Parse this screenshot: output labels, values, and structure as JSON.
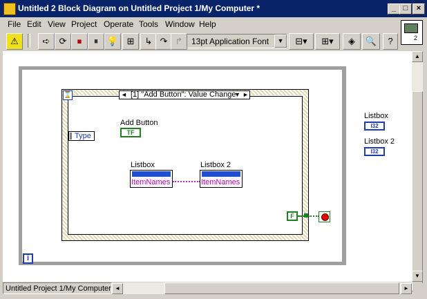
{
  "window": {
    "title": "Untitled 2 Block Diagram on Untitled Project 1/My Computer *"
  },
  "menu": {
    "items": [
      "File",
      "Edit",
      "View",
      "Project",
      "Operate",
      "Tools",
      "Window",
      "Help"
    ]
  },
  "toolbar": {
    "font": "13pt Application Font"
  },
  "diagram": {
    "case_selector": "[1] \"Add Button\": Value Change",
    "type_label": "Type",
    "add_button_label": "Add Button",
    "add_button_terminal": "TF",
    "listbox_label": "Listbox",
    "listbox2_label": "Listbox 2",
    "property": "ItemNames",
    "false_constant": "F",
    "info_glyph": "i",
    "right_listbox_label": "Listbox",
    "right_listbox2_label": "Listbox 2",
    "i32": "I32"
  },
  "status": {
    "context": "Untitled Project 1/My Computer"
  }
}
